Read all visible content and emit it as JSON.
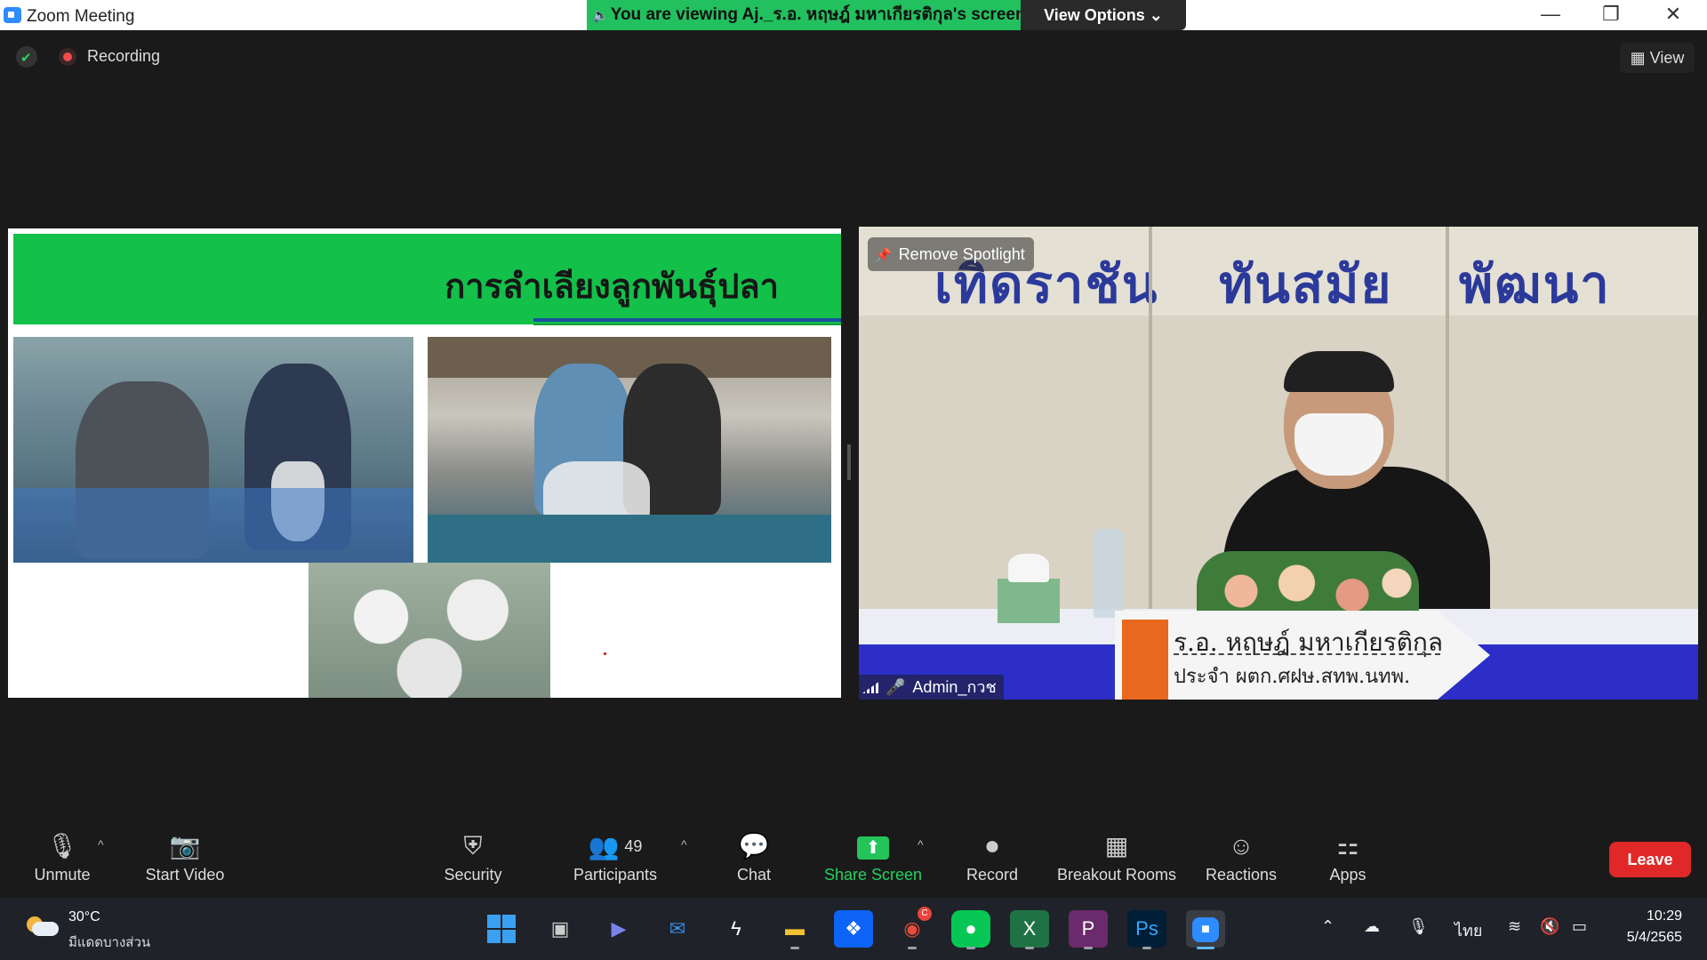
{
  "window": {
    "title": "Zoom Meeting",
    "share_banner": "You are viewing Aj._ร.อ. หฤษฎ์ มหาเกียรติกุล's screen",
    "view_options_label": "View Options",
    "view_options_caret": "⌄",
    "minimize_glyph": "—",
    "restore_glyph": "❐",
    "close_glyph": "✕"
  },
  "status": {
    "recording_label": "Recording",
    "view_label": "View",
    "view_icon": "▦"
  },
  "slide": {
    "title": "การลำเลียงลูกพันธุ์ปลา"
  },
  "speaker": {
    "banner_words": [
      "เทิดราชัน",
      "ทันสมัย",
      "พัฒนา"
    ],
    "nameplate_line1": "ร.อ. หฤษฎ์  มหาเกียรติกุล",
    "nameplate_line2": "ประจำ ผตก.ศฝษ.สทพ.นทพ.",
    "spotlight_label": "Remove Spotlight",
    "participant_name": "Admin_กวช"
  },
  "toolbar": {
    "unmute_label": "Unmute",
    "start_video_label": "Start Video",
    "security_label": "Security",
    "participants_label": "Participants",
    "participants_count": "49",
    "chat_label": "Chat",
    "share_screen_label": "Share Screen",
    "record_label": "Record",
    "breakout_rooms_label": "Breakout Rooms",
    "reactions_label": "Reactions",
    "apps_label": "Apps",
    "leave_label": "Leave",
    "caret": "^"
  },
  "taskbar": {
    "temperature": "30°C",
    "weather_desc": "มีแดดบางส่วน",
    "language": "ไทย",
    "time": "10:29",
    "date": "5/4/2565",
    "apps": [
      "windows-start",
      "task-view",
      "teams-chat",
      "mail",
      "skype-like",
      "file-explorer",
      "dropbox",
      "chrome",
      "line",
      "excel",
      "pdf",
      "photoshop",
      "zoom"
    ],
    "chrome_badge": "C"
  },
  "colors": {
    "zoom_blue": "#2d8cff",
    "share_green": "#22c05e",
    "leave_red": "#e02828",
    "slide_header_green": "#13c04a"
  }
}
